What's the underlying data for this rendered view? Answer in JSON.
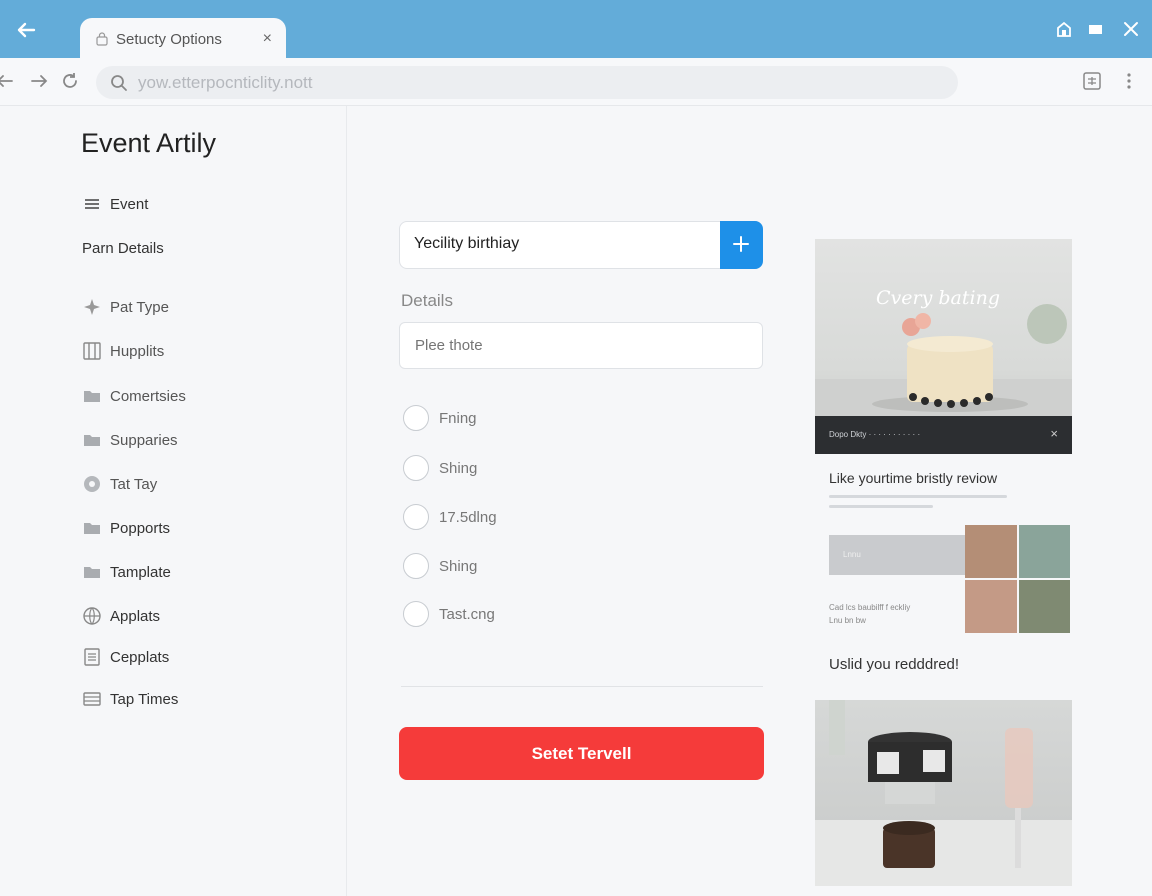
{
  "browser": {
    "tab_title": "Setucty Options",
    "tab_close": "×",
    "url": "yow.etterpocnticlity.nott"
  },
  "sidebar": {
    "title": "Event Artily",
    "items": [
      {
        "label": "Event",
        "icon": "list-icon"
      },
      {
        "label": "Parn Details",
        "icon": ""
      },
      {
        "label": "Pat Type",
        "icon": "sparkle-icon"
      },
      {
        "label": "Hupplits",
        "icon": "columns-icon"
      },
      {
        "label": "Comertsies",
        "icon": "folder-icon"
      },
      {
        "label": "Supparies",
        "icon": "folder-icon"
      },
      {
        "label": "Tat Tay",
        "icon": "gear-circle-icon"
      },
      {
        "label": "Popports",
        "icon": "folder-icon"
      },
      {
        "label": "Tamplate",
        "icon": "folder-icon"
      },
      {
        "label": "Applats",
        "icon": "globe-icon"
      },
      {
        "label": "Cepplats",
        "icon": "document-icon"
      },
      {
        "label": "Tap Times",
        "icon": "stack-icon"
      }
    ]
  },
  "main": {
    "event_name_value": "Yecility birthiay",
    "details_label": "Details",
    "details_placeholder": "Plee thote",
    "options": [
      "Fning",
      "Shing",
      "17.5dlng",
      "Shing",
      "Tast.cng"
    ],
    "submit_label": "Setet Tervell"
  },
  "preview": {
    "photo_title": "Cvery bating",
    "banner_text": "Dopo Dkty  ·  ·  ·  ·  ·  ·  ·  ·  ·  ·  ·",
    "banner_close": "×",
    "heading": "Like yourtime bristly reviow",
    "bar_text": "Lnnu",
    "sub_text_1": "Cad lcs baubilff f eckliy",
    "sub_text_2": "Lnu bn bw",
    "final_heading": "Uslid you redddred!"
  },
  "colors": {
    "titlebar": "#63acd9",
    "accent_blue": "#1e90e8",
    "submit_red": "#f53b3a"
  }
}
